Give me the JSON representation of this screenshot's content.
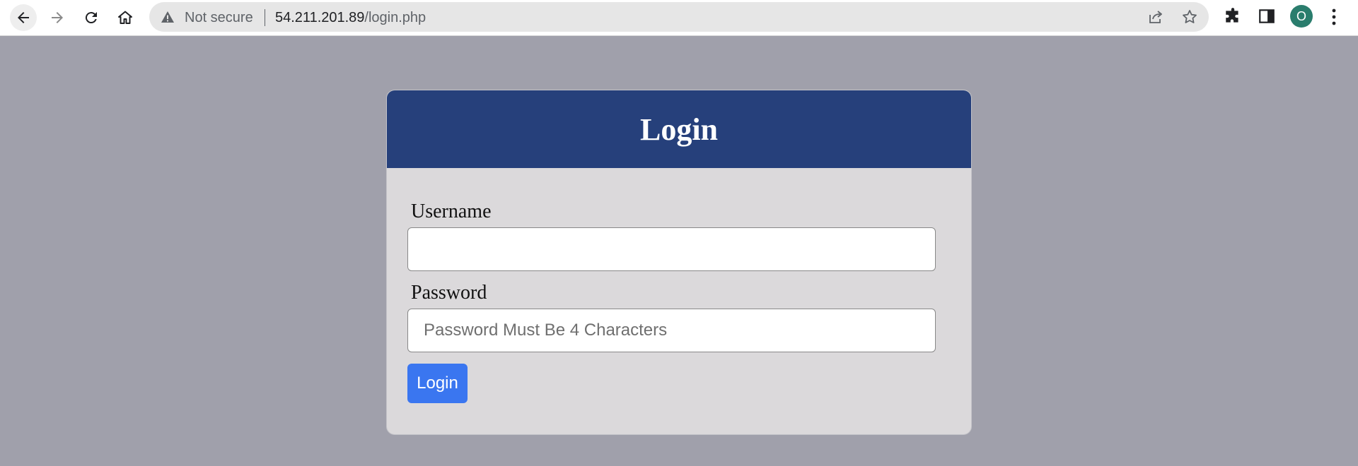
{
  "browser": {
    "security_label": "Not secure",
    "url_host": "54.211.201.89",
    "url_path": "/login.php",
    "avatar_letter": "O",
    "icons": [
      "back-arrow-icon",
      "forward-arrow-icon",
      "reload-icon",
      "home-icon",
      "warning-icon",
      "share-icon",
      "star-icon",
      "extensions-icon",
      "side-panel-icon",
      "more-vert-icon"
    ]
  },
  "login_form": {
    "title": "Login",
    "username_label": "Username",
    "username_value": "",
    "password_label": "Password",
    "password_placeholder": "Password Must Be 4 Characters",
    "submit_label": "Login"
  },
  "colors": {
    "page_background": "#a0a0ab",
    "header_background": "#26407b",
    "card_background": "#dbd9db",
    "button_background": "#3a76f0",
    "avatar_background": "#2a7d6d"
  }
}
